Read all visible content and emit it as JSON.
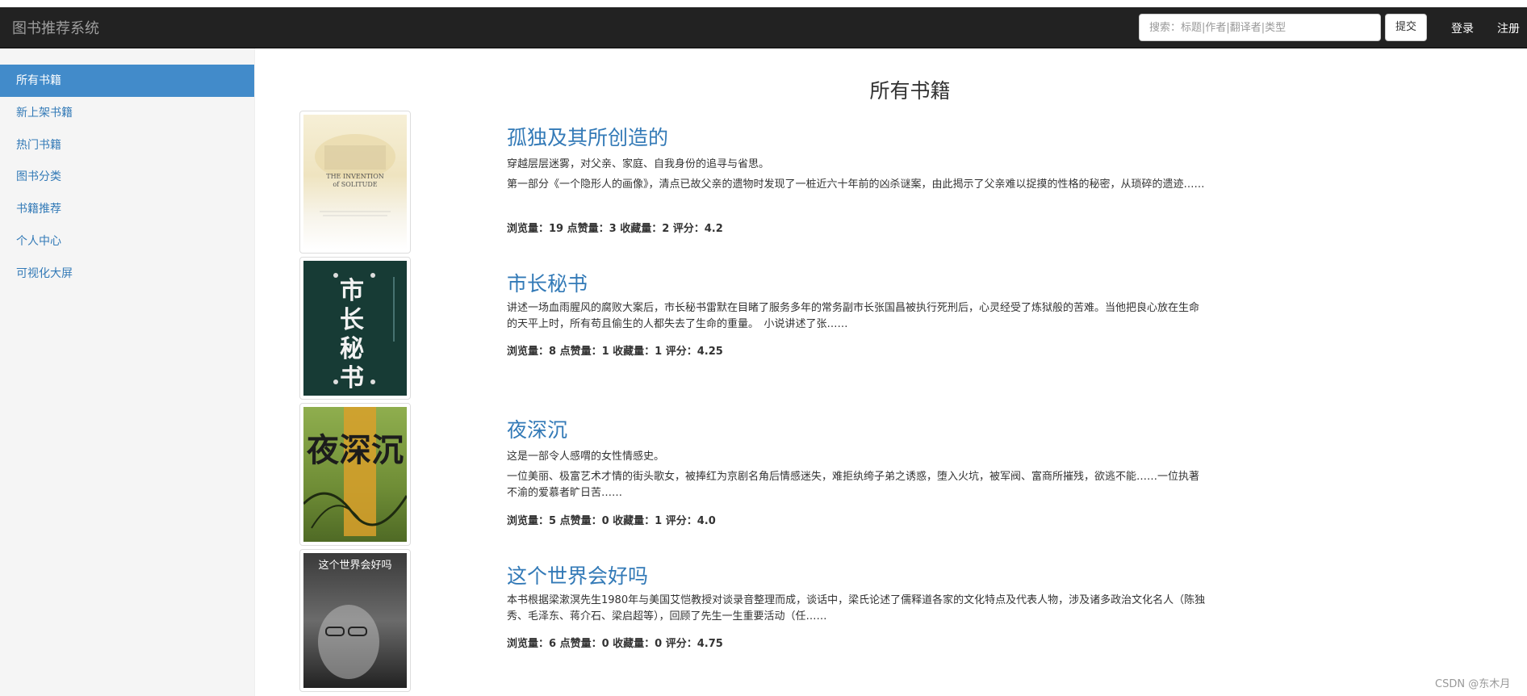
{
  "navbar": {
    "brand": "图书推荐系统",
    "search_placeholder": "搜索：标题|作者|翻译者|类型",
    "submit_label": "提交",
    "login_label": "登录",
    "register_label": "注册"
  },
  "sidebar": {
    "items": [
      {
        "label": "所有书籍",
        "active": true
      },
      {
        "label": "新上架书籍",
        "active": false
      },
      {
        "label": "热门书籍",
        "active": false
      },
      {
        "label": "图书分类",
        "active": false
      },
      {
        "label": "书籍推荐",
        "active": false
      },
      {
        "label": "个人中心",
        "active": false
      },
      {
        "label": "可视化大屏",
        "active": false
      }
    ]
  },
  "main": {
    "title": "所有书籍",
    "books": [
      {
        "title": "孤独及其所创造的",
        "subtitle": "穿越层层迷雾，对父亲、家庭、自我身份的追寻与省思。",
        "description": "第一部分《一个隐形人的画像》，清点已故父亲的遗物时发现了一桩近六十年前的凶杀谜案，由此揭示了父亲难以捉摸的性格的秘密，从琐碎的遗迹……",
        "stats": "浏览量：19 点赞量：3 收藏量：2 评分：4.2",
        "cover_text": "THE INVENTION of SOLITUDE"
      },
      {
        "title": "市长秘书",
        "subtitle": "",
        "description": "讲述一场血雨腥风的腐败大案后，市长秘书雷默在目睹了服务多年的常务副市长张国昌被执行死刑后，心灵经受了炼狱般的苦难。当他把良心放在生命的天平上时，所有苟且偷生的人都失去了生命的重量。　小说讲述了张……",
        "stats": "浏览量：8 点赞量：1 收藏量：1 评分：4.25",
        "cover_text": "市长秘书"
      },
      {
        "title": "夜深沉",
        "subtitle": "这是一部令人感喟的女性情感史。",
        "description": "一位美丽、极富艺术才情的街头歌女，被捧红为京剧名角后情感迷失，难拒纨绔子弟之诱惑，堕入火坑，被军阀、富商所摧残，欲逃不能……一位执著不渝的爱慕者旷日苦……",
        "stats": "浏览量：5 点赞量：0 收藏量：1 评分：4.0",
        "cover_text": "夜深沉"
      },
      {
        "title": "这个世界会好吗",
        "subtitle": "",
        "description": "本书根据梁漱溟先生1980年与美国艾恺教授对谈录音整理而成，谈话中，梁氏论述了儒释道各家的文化特点及代表人物，涉及诸多政治文化名人（陈独秀、毛泽东、蒋介石、梁启超等），回顾了先生一生重要活动（任……",
        "stats": "浏览量：6 点赞量：0 收藏量：0 评分：4.75",
        "cover_text": "这个世界会好吗"
      }
    ]
  },
  "watermark": "CSDN @东木月",
  "colors": {
    "navbar": "#222222",
    "link": "#337ab7",
    "active": "#428bca",
    "sidebar_bg": "#f5f5f5"
  }
}
